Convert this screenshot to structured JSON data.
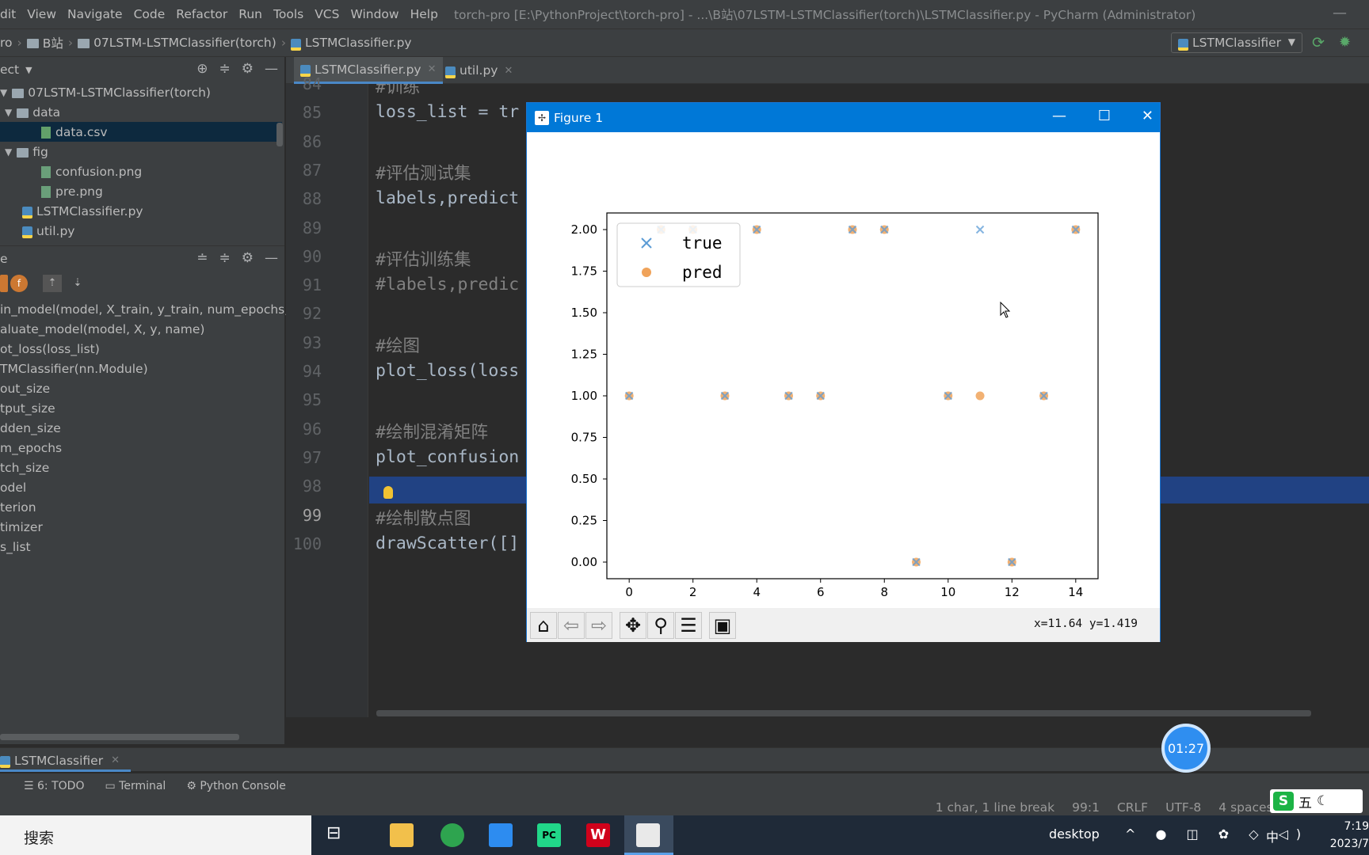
{
  "menubar": {
    "items": [
      "dit",
      "View",
      "Navigate",
      "Code",
      "Refactor",
      "Run",
      "Tools",
      "VCS",
      "Window",
      "Help"
    ],
    "window_title": "torch-pro [E:\\PythonProject\\torch-pro] - ...\\B站\\07LSTM-LSTMClassifier(torch)\\LSTMClassifier.py - PyCharm (Administrator)",
    "minimize": "—"
  },
  "breadcrumb": {
    "root": "ro",
    "folder1": "B站",
    "folder2": "07LSTM-LSTMClassifier(torch)",
    "file": "LSTMClassifier.py"
  },
  "run_config": {
    "label": "LSTMClassifier",
    "run_icon": "run-icon",
    "debug_icon": "debug-icon"
  },
  "project_panel": {
    "title": "ect",
    "tree": [
      {
        "label": "07LSTM-LSTMClassifier(torch)",
        "type": "folder"
      },
      {
        "label": "data",
        "type": "folder"
      },
      {
        "label": "data.csv",
        "type": "file"
      },
      {
        "label": "fig",
        "type": "folder"
      },
      {
        "label": "confusion.png",
        "type": "image"
      },
      {
        "label": "pre.png",
        "type": "image"
      },
      {
        "label": "LSTMClassifier.py",
        "type": "python"
      },
      {
        "label": "util.py",
        "type": "python"
      }
    ]
  },
  "structure_panel": {
    "title": "e",
    "items": [
      "in_model(model, X_train, y_train, num_epochs, ba",
      "aluate_model(model, X, y, name)",
      "ot_loss(loss_list)",
      "TMClassifier(nn.Module)",
      "out_size",
      "tput_size",
      "dden_size",
      "m_epochs",
      "tch_size",
      "odel",
      "terion",
      "timizer",
      "s_list"
    ]
  },
  "editor": {
    "tabs": [
      {
        "label": "LSTMClassifier.py",
        "active": true
      },
      {
        "label": "util.py",
        "active": false
      }
    ],
    "lines": [
      {
        "num": "84",
        "text": "#训练",
        "comment": true
      },
      {
        "num": "85",
        "text": "loss_list = tr",
        "comment": false
      },
      {
        "num": "86",
        "text": "",
        "comment": false
      },
      {
        "num": "87",
        "text": "#评估测试集",
        "comment": true
      },
      {
        "num": "88",
        "text": "labels,predict",
        "comment": false
      },
      {
        "num": "89",
        "text": "",
        "comment": false
      },
      {
        "num": "90",
        "text": "#评估训练集",
        "comment": true
      },
      {
        "num": "91",
        "text": "#labels,predic",
        "comment": true
      },
      {
        "num": "92",
        "text": "",
        "comment": false
      },
      {
        "num": "93",
        "text": "#绘图",
        "comment": true
      },
      {
        "num": "94",
        "text": "plot_loss(loss",
        "comment": false
      },
      {
        "num": "95",
        "text": "",
        "comment": false
      },
      {
        "num": "96",
        "text": "#绘制混淆矩阵",
        "comment": true
      },
      {
        "num": "97",
        "text": "plot_confusion",
        "comment": false
      },
      {
        "num": "98",
        "text": "",
        "comment": false
      },
      {
        "num": "99",
        "text": "#绘制散点图",
        "comment": true
      },
      {
        "num": "100",
        "text": "drawScatter([]",
        "comment": false
      }
    ]
  },
  "figure": {
    "title": "Figure 1",
    "coords": "x=11.64 y=1.419",
    "toolbar": [
      "home-icon",
      "back-icon",
      "forward-icon",
      "pan-icon",
      "zoom-icon",
      "configure-icon",
      "save-icon"
    ]
  },
  "chart_data": {
    "type": "scatter",
    "title": "",
    "xlabel": "",
    "ylabel": "",
    "xlim": [
      -0.7,
      14.7
    ],
    "ylim": [
      -0.1,
      2.1
    ],
    "xticks": [
      0,
      2,
      4,
      6,
      8,
      10,
      12,
      14
    ],
    "yticks": [
      0.0,
      0.25,
      0.5,
      0.75,
      1.0,
      1.25,
      1.5,
      1.75,
      2.0
    ],
    "ytick_labels": [
      "0.00",
      "0.25",
      "0.50",
      "0.75",
      "1.00",
      "1.25",
      "1.50",
      "1.75",
      "2.00"
    ],
    "legend_position": "top-left",
    "series": [
      {
        "name": "true",
        "marker": "x",
        "color": "#5b9bd5",
        "x": [
          0,
          1,
          2,
          3,
          4,
          5,
          6,
          7,
          8,
          9,
          10,
          11,
          12,
          13,
          14
        ],
        "y": [
          1,
          2,
          2,
          1,
          2,
          1,
          1,
          2,
          2,
          0,
          1,
          2,
          0,
          1,
          2
        ]
      },
      {
        "name": "pred",
        "marker": "o",
        "color": "#f0a35a",
        "x": [
          0,
          1,
          2,
          3,
          4,
          5,
          6,
          7,
          8,
          9,
          10,
          11,
          12,
          13,
          14
        ],
        "y": [
          1,
          2,
          2,
          1,
          2,
          1,
          1,
          2,
          2,
          0,
          1,
          1,
          0,
          1,
          2
        ]
      }
    ]
  },
  "bottom": {
    "run_tab": "LSTMClassifier",
    "tools": [
      "6: TODO",
      "Terminal",
      "Python Console"
    ],
    "status": [
      "1 char, 1 line break",
      "99:1",
      "CRLF",
      "UTF-8",
      "4 spaces",
      "P"
    ]
  },
  "timer": "01:27",
  "taskbar": {
    "search": "搜索",
    "desktop": "desktop",
    "clock_time": "7:19",
    "clock_date": "2023/7",
    "ime": "中",
    "ime_bar": "五"
  }
}
